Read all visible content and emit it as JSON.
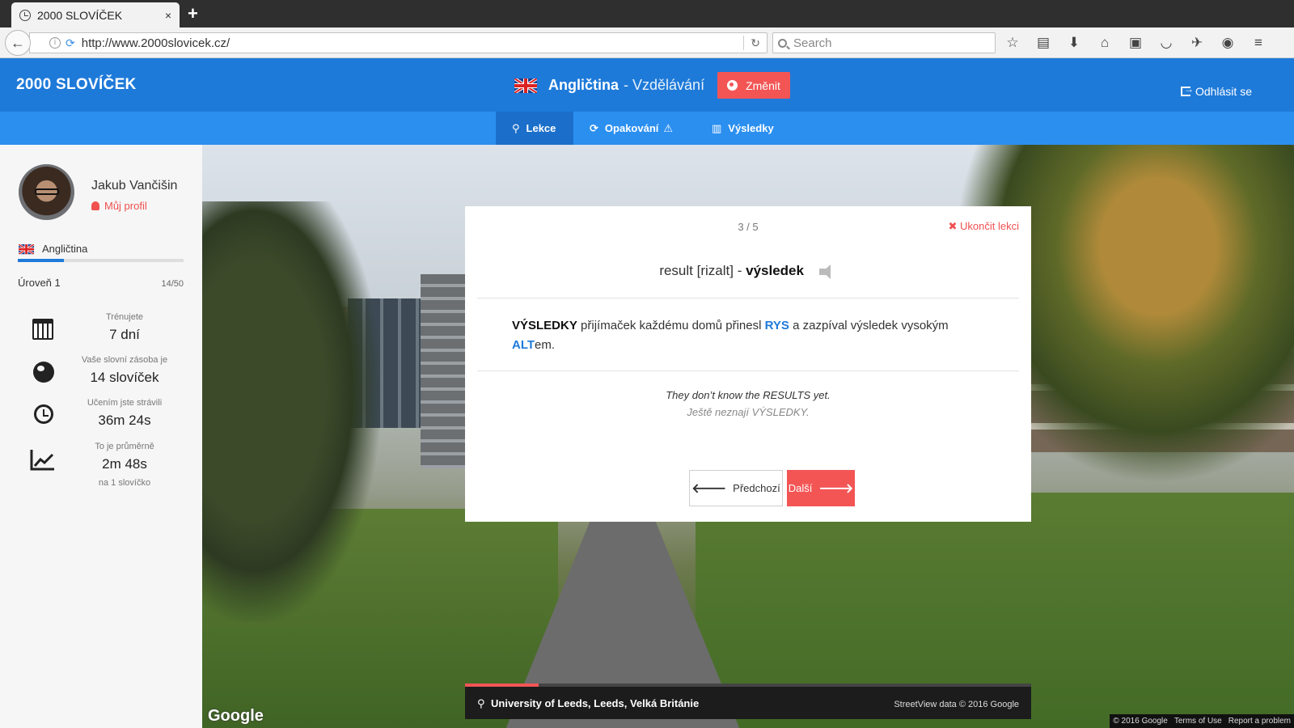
{
  "browser": {
    "tab_title": "2000 SLOVÍČEK",
    "tab_close": "×",
    "new_tab": "+",
    "url": "http://www.2000slovicek.cz/",
    "search_placeholder": "Search"
  },
  "header": {
    "brand": "2000 SLOVÍČEK",
    "language": "Angličtina",
    "language_mode": "- Vzdělávání",
    "change_label": "Změnit",
    "logout_label": "Odhlásit se"
  },
  "nav": {
    "items": [
      {
        "label": "Lekce",
        "icon": "map-pin-icon",
        "active": true
      },
      {
        "label": "Opakování",
        "icon": "refresh-icon",
        "warning": true
      },
      {
        "label": "Výsledky",
        "icon": "bar-chart-icon"
      }
    ]
  },
  "sidebar": {
    "user_name": "Jakub Vančišin",
    "profile_label": "Můj profil",
    "language": "Angličtina",
    "level_label": "Úroveň 1",
    "level_count": "14/50",
    "level_progress": 0.28,
    "stats": [
      {
        "label": "Trénujete",
        "value": "7 dní",
        "icon": "calendar-icon"
      },
      {
        "label": "Vaše slovní zásoba je",
        "value": "14 slovíček",
        "icon": "globe-icon"
      },
      {
        "label": "Učením jste strávili",
        "value": "36m 24s",
        "icon": "clock-icon"
      },
      {
        "label": "To je průměrně",
        "value": "2m 48s",
        "sub": "na 1 slovíčko",
        "icon": "trend-chart-icon"
      }
    ]
  },
  "lesson": {
    "counter": "3 / 5",
    "end_label": "Ukončit lekci",
    "word_en": "result",
    "pronunciation": "[rizalt]",
    "dash": "-",
    "word_cs": "výsledek",
    "mnemonic": {
      "p1_caps": "VÝSLEDKY",
      "p2": " přijímaček každému domů přinesl ",
      "p3_hl": "RYS",
      "p4": " a zazpíval výsledek vysokým ",
      "p5_hl": "ALT",
      "p6": "em."
    },
    "example_en": "They don’t know the RESULTS yet.",
    "example_cs": "Ještě neznají VÝSLEDKY.",
    "prev_label": "Předchozí",
    "next_label": "Další"
  },
  "location": {
    "place": "University of Leeds, Leeds, Velká Británie",
    "credit": "StreetView data © 2016 Google",
    "load_progress": 0.13
  },
  "map": {
    "google_logo": "Google",
    "copyright": "© 2016 Google",
    "terms": "Terms of Use",
    "report": "Report a problem"
  },
  "colors": {
    "primary": "#1e7ad9",
    "nav": "#2b8ff0",
    "accent": "#f35555"
  }
}
